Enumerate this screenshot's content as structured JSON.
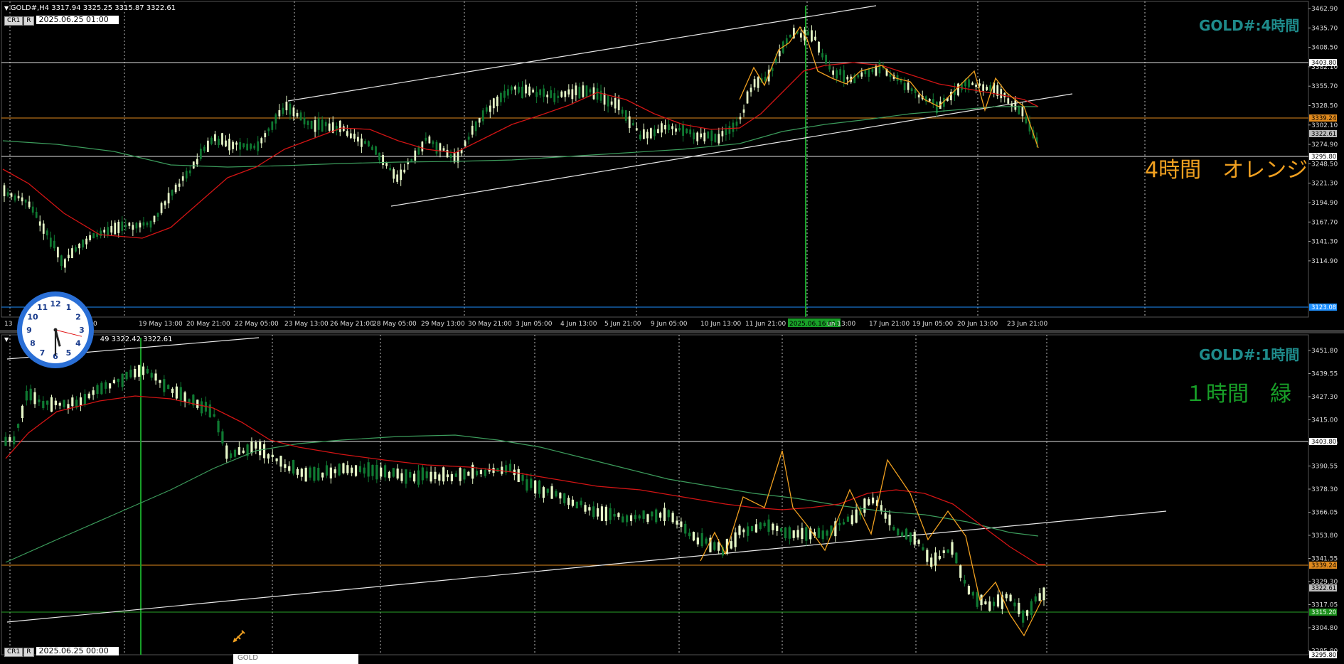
{
  "colors": {
    "background": "#000000",
    "bull": "#e6f8c8",
    "bear": "#0f7a32",
    "ma_red": "#d21414",
    "ma_green": "#3c9c5c",
    "zigzag": "#f0a020",
    "trendline": "#e8e8e8",
    "hline_white": "#e0e0e0",
    "hline_orange": "#e08a1e",
    "hline_blue": "#1e90ff",
    "hline_green": "#2aa52a",
    "vline_green": "#18a028",
    "grid": "#bbbbbb",
    "title": "#1e8b8b",
    "note_orange": "#f0a020",
    "note_green": "#18a028"
  },
  "pane1": {
    "header": "GOLD#,H4  3317.94 3325.25 3315.87 3322.61",
    "buttons": [
      "CR1",
      "R"
    ],
    "date_box": "2025.06.25 01:00",
    "title": "GOLD#:4時間",
    "note": "4時間　オレンジ",
    "price_labels": [
      "3462.90",
      "3435.70",
      "3408.50",
      "3382.10",
      "3355.70",
      "3328.50",
      "3302.10",
      "3274.90",
      "3248.50",
      "3221.30",
      "3194.90",
      "3167.70",
      "3141.30",
      "3114.90"
    ],
    "tags": [
      {
        "text": "3403.80",
        "kind": "white"
      },
      {
        "text": "3339.24",
        "kind": "orange"
      },
      {
        "text": "3322.61",
        "kind": "gray"
      },
      {
        "text": "3295.80",
        "kind": "white"
      },
      {
        "text": "3123.08",
        "kind": "blue"
      }
    ],
    "time_labels": [
      "13",
      "16 May 05:00",
      "19 May 13:00",
      "20 May 21:00",
      "22 May 05:00",
      "23 May 13:00",
      "26 May 21:00",
      "28 May 05:00",
      "29 May 13:00",
      "30 May 21:00",
      "3 Jun 05:00",
      "4 Jun 13:00",
      "5 Jun 21:00",
      "9 Jun 05:00",
      "10 Jun 13:00",
      "11 Jun 21:00",
      "2025.06.16 01:00",
      "un 13:00",
      "17 Jun 21:00",
      "19 Jun 05:00",
      "20 Jun 13:00",
      "23 Jun 21:00"
    ],
    "highlighted_time": "2025.06.16 01:00"
  },
  "pane2": {
    "header": "49 3322.42 3322.61",
    "buttons": [
      "CR1",
      "R"
    ],
    "date_box": "2025.06.25 00:00",
    "title": "GOLD#:1時間",
    "note": "１時間　緑",
    "price_labels": [
      "3451.80",
      "3439.55",
      "3427.30",
      "3415.00",
      "3403.80",
      "3390.55",
      "3378.30",
      "3366.05",
      "3353.80",
      "3341.55",
      "3329.30",
      "3317.05",
      "3304.80",
      "3295.80"
    ],
    "tags": [
      {
        "text": "3403.80",
        "kind": "white"
      },
      {
        "text": "3339.24",
        "kind": "orange"
      },
      {
        "text": "3322.61",
        "kind": "gray"
      },
      {
        "text": "3315.20",
        "kind": "green"
      },
      {
        "text": "3295.80",
        "kind": "white"
      }
    ]
  },
  "clock": {
    "label": "clock",
    "hour": 5,
    "minute": 30,
    "second": 9
  },
  "tooltip_text": "GOLD"
}
